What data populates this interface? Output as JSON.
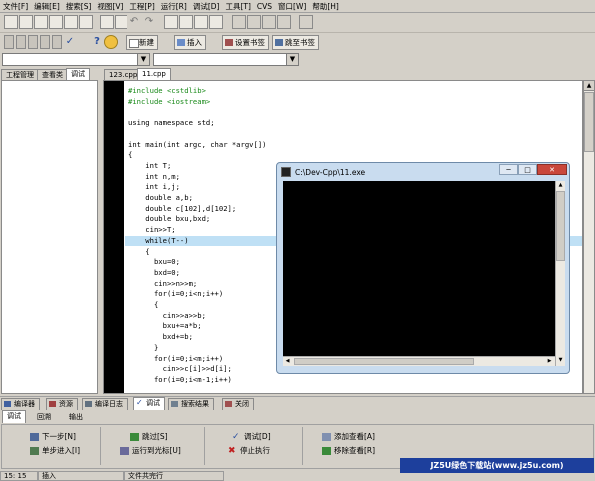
{
  "menu": [
    "文件[F]",
    "编辑[E]",
    "搜索[S]",
    "视图[V]",
    "工程[P]",
    "运行[R]",
    "调试[D]",
    "工具[T]",
    "CVS",
    "窗口[W]",
    "帮助[H]"
  ],
  "toolbar2": {
    "new_label": "新建",
    "insert_label": "插入",
    "set_bookmark_label": "设置书签",
    "goto_bookmark_label": "跳至书签"
  },
  "left_tabs": [
    "工程管理",
    "查看类",
    "调试"
  ],
  "editor_tabs": [
    "123.cpp",
    "11.cpp"
  ],
  "code_lines": [
    {
      "text": "#include <cstdlib>",
      "pp": true
    },
    {
      "text": "#include <iostream>",
      "pp": true
    },
    {
      "text": "",
      "pp": false
    },
    {
      "text": "using namespace std;",
      "pp": false
    },
    {
      "text": "",
      "pp": false
    },
    {
      "text": "int main(int argc, char *argv[])",
      "pp": false
    },
    {
      "text": "{",
      "pp": false
    },
    {
      "text": "    int T;",
      "pp": false
    },
    {
      "text": "    int n,m;",
      "pp": false
    },
    {
      "text": "    int i,j;",
      "pp": false
    },
    {
      "text": "    double a,b;",
      "pp": false
    },
    {
      "text": "    double c[102],d[102];",
      "pp": false
    },
    {
      "text": "    double bxu,bxd;",
      "pp": false
    },
    {
      "text": "    cin>>T;",
      "pp": false
    },
    {
      "text": "    while(T--)",
      "pp": false
    },
    {
      "text": "    {",
      "pp": false
    },
    {
      "text": "      bxu=0;",
      "pp": false
    },
    {
      "text": "      bxd=0;",
      "pp": false
    },
    {
      "text": "      cin>>n>>m;",
      "pp": false
    },
    {
      "text": "      for(i=0;i<n;i++)",
      "pp": false
    },
    {
      "text": "      {",
      "pp": false
    },
    {
      "text": "        cin>>a>>b;",
      "pp": false
    },
    {
      "text": "        bxu+=a*b;",
      "pp": false
    },
    {
      "text": "        bxd+=b;",
      "pp": false
    },
    {
      "text": "      }",
      "pp": false
    },
    {
      "text": "      for(i=0;i<m;i++)",
      "pp": false
    },
    {
      "text": "        cin>>c[i]>>d[i];",
      "pp": false
    },
    {
      "text": "      for(i=0;i<m-1;i++)",
      "pp": false
    }
  ],
  "console": {
    "title": "C:\\Dev-Cpp\\11.exe",
    "minimize": "─",
    "maximize": "□",
    "close": "✕"
  },
  "bottom_tabs": [
    "编译器",
    "资源",
    "编译日志",
    "调试",
    "搜索结果",
    "关闭"
  ],
  "debug_subtabs": [
    "调试",
    "回溯",
    "输出"
  ],
  "debug_buttons": {
    "next_step": "下一步[N]",
    "step_into": "单步进入[I]",
    "skip": "跳过[S]",
    "run_to_cursor": "运行到光标[U]",
    "debug": "调试[D]",
    "stop": "停止执行",
    "add_watch": "添加查看[A]",
    "remove_watch": "移除查看[R]"
  },
  "status": {
    "position": "15: 15",
    "mode": "插入",
    "file_status": "文件共完行"
  },
  "watermark": "JZ5U绿色下载站(www.jz5u.com)",
  "colors": {
    "console_bg": "#000000",
    "highlight_line": "#bfe0f5",
    "gutter": "#000000",
    "watermark_bg": "#1d3f9c"
  }
}
